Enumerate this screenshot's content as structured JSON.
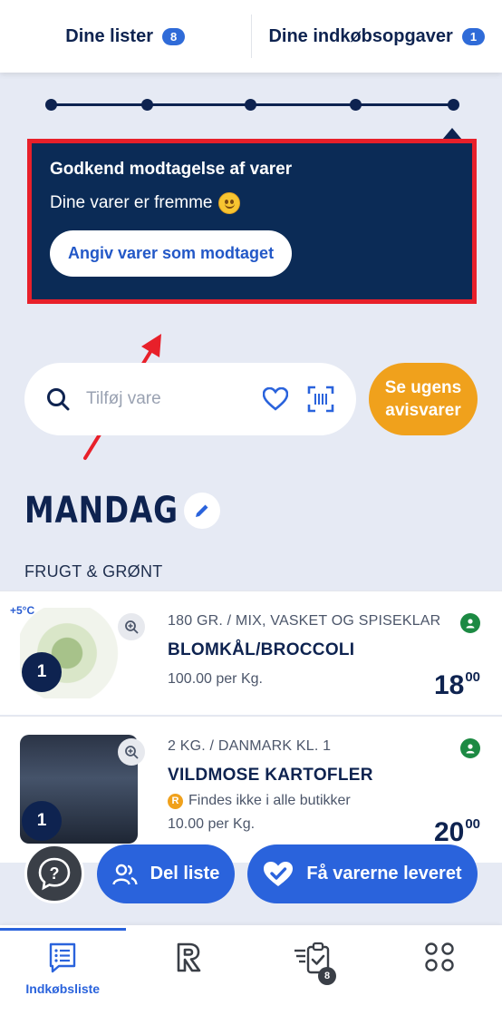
{
  "top_tabs": [
    {
      "label": "Dine lister",
      "badge": "8"
    },
    {
      "label": "Dine indkøbsopgaver",
      "badge": "1"
    }
  ],
  "notice": {
    "title": "Godkend modtagelse af varer",
    "message": "Dine varer er fremme",
    "button_label": "Angiv varer som modtaget"
  },
  "progress": {
    "steps_total": 5,
    "current_step": 5
  },
  "search": {
    "placeholder": "Tilføj vare"
  },
  "offers_button": {
    "line1": "Se ugens",
    "line2": "avisvarer"
  },
  "day": {
    "name": "MANDAG"
  },
  "category": "FRUGT & GRØNT",
  "products": [
    {
      "temperature": "+5°C",
      "quantity": "1",
      "size": "180 GR. / MIX, VASKET OG SPISEKLAR",
      "name": "BLOMKÅL/BROCCOLI",
      "unit_price": "100.00 per Kg.",
      "price_whole": "18",
      "price_cents": "00"
    },
    {
      "quantity": "1",
      "size": "2 KG. / DANMARK KL. 1",
      "name": "VILDMOSE KARTOFLER",
      "note": "Findes ikke i alle butikker",
      "note_icon": "R",
      "unit_price": "10.00 per Kg.",
      "price_whole": "20",
      "price_cents": "00"
    }
  ],
  "actions": {
    "share_label": "Del liste",
    "deliver_label": "Få varerne leveret"
  },
  "bottom_nav": {
    "items": [
      {
        "label": "Indkøbsliste",
        "icon": "shopping-list-icon"
      },
      {
        "label": "",
        "icon": "rema-r-icon"
      },
      {
        "label": "",
        "icon": "task-clipboard-icon",
        "badge": "8"
      },
      {
        "label": "",
        "icon": "more-grid-icon"
      }
    ]
  },
  "colors": {
    "primary": "#2a63dc",
    "navy": "#0e2350",
    "notice_bg": "#0b2b56",
    "annotation_red": "#e8202a",
    "accent_orange": "#f0a11c",
    "background": "#e6eaf4"
  }
}
